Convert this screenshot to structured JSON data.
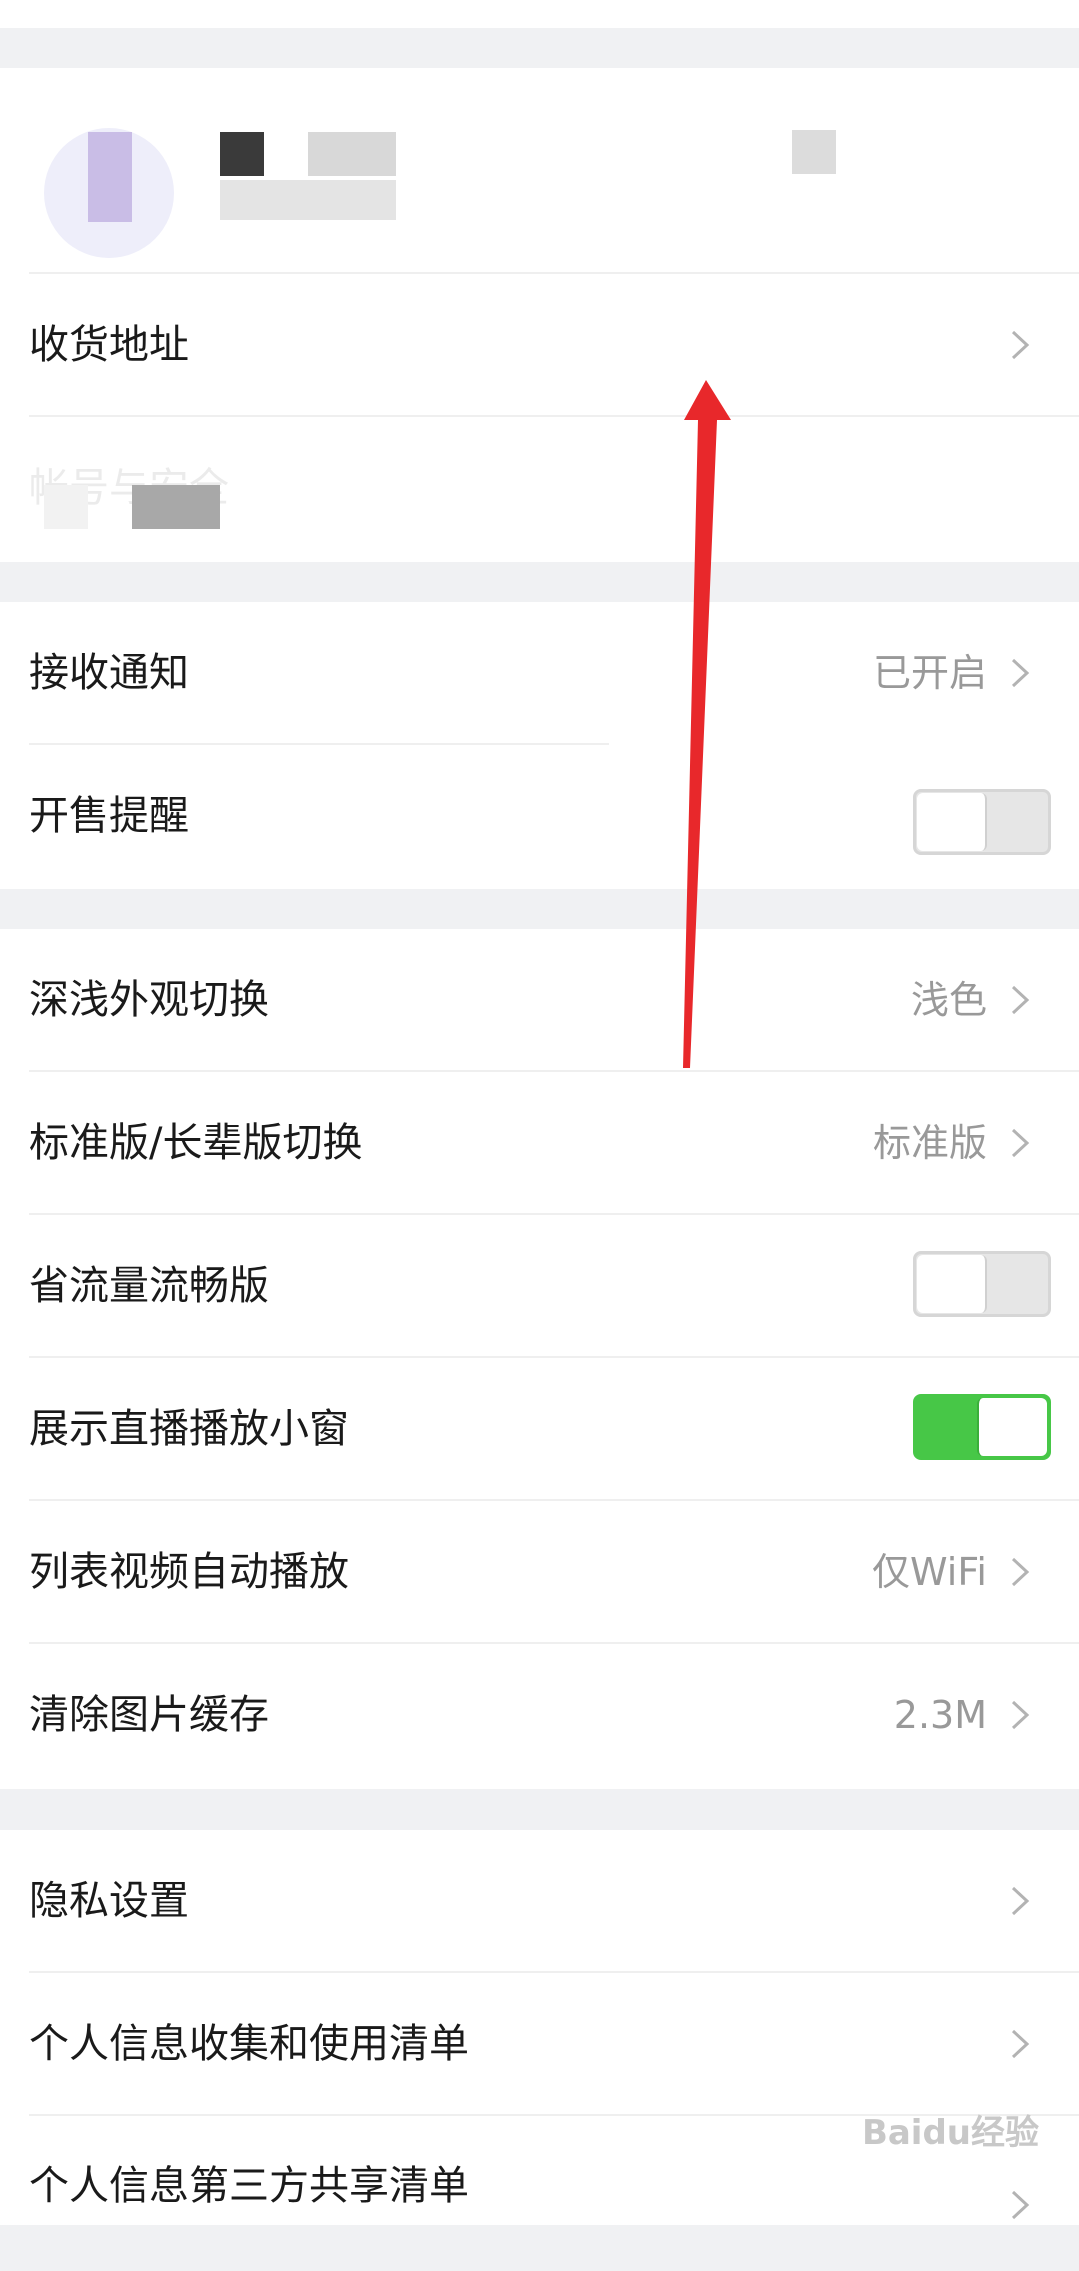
{
  "profile": {
    "name": "",
    "account": ""
  },
  "account_section": {
    "shipping_address": "收货地址",
    "account_security": "帐号与安全"
  },
  "notify_section": {
    "receive_notifications": {
      "label": "接收通知",
      "value": "已开启"
    },
    "sale_reminder": {
      "label": "开售提醒",
      "on": false
    }
  },
  "display_section": {
    "appearance": {
      "label": "深浅外观切换",
      "value": "浅色"
    },
    "edition": {
      "label": "标准版/长辈版切换",
      "value": "标准版"
    },
    "data_saver": {
      "label": "省流量流畅版",
      "on": false
    },
    "live_mini_window": {
      "label": "展示直播播放小窗",
      "on": true
    },
    "autoplay_video": {
      "label": "列表视频自动播放",
      "value": "仅WiFi"
    },
    "clear_cache": {
      "label": "清除图片缓存",
      "value": "2.3M"
    }
  },
  "privacy_section": {
    "privacy_settings": "隐私设置",
    "personal_info_list": "个人信息收集和使用清单",
    "third_party_list": "个人信息第三方共享清单"
  },
  "watermark": "Baidu经验",
  "colors": {
    "toggle_on": "#47c747",
    "annotation_arrow": "#e8282b"
  }
}
